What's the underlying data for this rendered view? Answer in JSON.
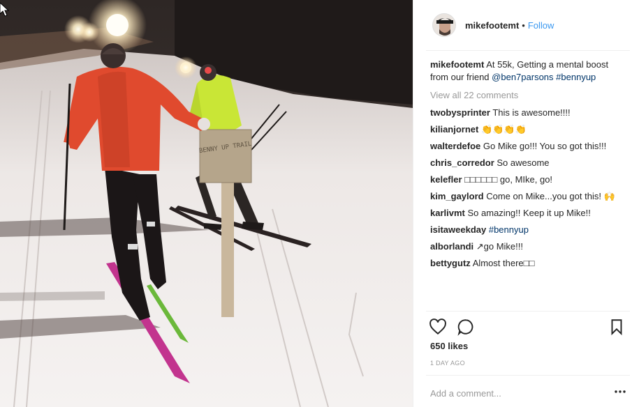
{
  "post": {
    "username": "mikefootemt",
    "follow_label": "Follow",
    "separator": "•"
  },
  "caption": {
    "username": "mikefootemt",
    "text": "At 55k, Getting a mental boost from our friend",
    "mention": "@ben7parsons",
    "hashtag": "#bennyup"
  },
  "view_all_label": "View all 22 comments",
  "comments": [
    {
      "user": "twobysprinter",
      "text": "This is awesome!!!!"
    },
    {
      "user": "kilianjornet",
      "text": "👏👏👏👏"
    },
    {
      "user": "walterdefoe",
      "text": "Go Mike go!!! You so got this!!!"
    },
    {
      "user": "chris_corredor",
      "text": "So awesome"
    },
    {
      "user": "kelefler",
      "text": "□□□□□□ go, MIke, go!"
    },
    {
      "user": "kim_gaylord",
      "text": "Come on Mike...you got this! 🙌"
    },
    {
      "user": "karlivmt",
      "text": "So amazing!! Keep it up Mike!!"
    },
    {
      "user": "isitaweekday",
      "text": "",
      "hashtag": "#bennyup"
    },
    {
      "user": "alborlandi",
      "text": "↗go Mike!!!"
    },
    {
      "user": "bettygutz",
      "text": "Almost there□□"
    }
  ],
  "likes_label": "650 likes",
  "time_label": "1 DAY AGO",
  "add_comment_placeholder": "Add a comment...",
  "photo": {
    "sign_text": "BENNY UP TRAIL"
  },
  "icons": {
    "like": "heart-icon",
    "comment": "speech-bubble-icon",
    "save": "bookmark-icon",
    "more": "ellipsis-icon",
    "cursor": "mouse-pointer-icon"
  },
  "colors": {
    "link": "#003569",
    "follow": "#3897f0",
    "muted": "#999999",
    "text": "#262626"
  }
}
